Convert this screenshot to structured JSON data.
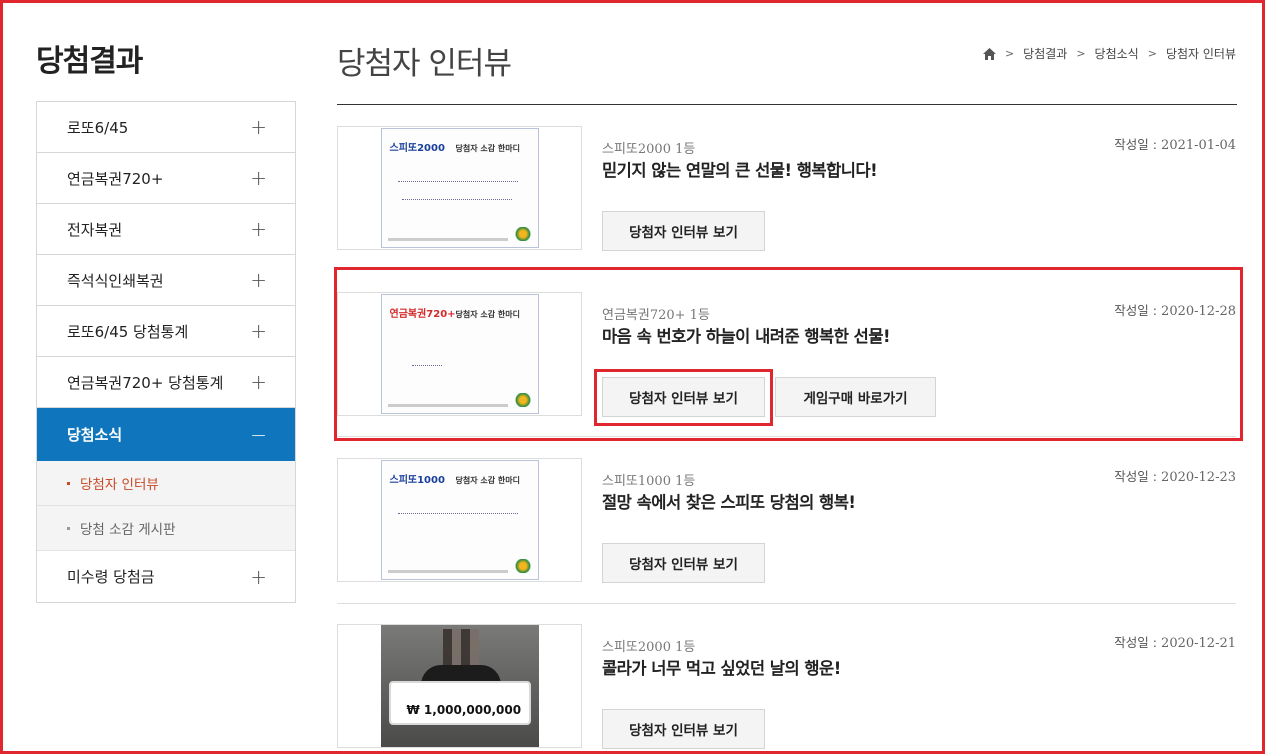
{
  "sidebar": {
    "title": "당첨결과",
    "items": [
      {
        "label": "로또6/45",
        "toggle": "+"
      },
      {
        "label": "연금복권720+",
        "toggle": "+"
      },
      {
        "label": "전자복권",
        "toggle": "+"
      },
      {
        "label": "즉석식인쇄복권",
        "toggle": "+"
      },
      {
        "label": "로또6/45 당첨통계",
        "toggle": "+"
      },
      {
        "label": "연금복권720+ 당첨통계",
        "toggle": "+"
      },
      {
        "label": "당첨소식",
        "toggle": "−"
      },
      {
        "label": "미수령 당첨금",
        "toggle": "+"
      }
    ],
    "subitems": [
      {
        "label": "당첨자 인터뷰"
      },
      {
        "label": "당첨 소감 게시판"
      }
    ]
  },
  "header": {
    "title": "당첨자 인터뷰",
    "breadcrumb": [
      "당첨결과",
      "당첨소식",
      "당첨자 인터뷰"
    ],
    "home_icon": "home-icon"
  },
  "interviews": [
    {
      "category": "스피또2000 1등",
      "title": "믿기지 않는 연말의 큰 선물! 행복합니다!",
      "date_label": "작성일 :",
      "date": "2021-01-04",
      "view_button": "당첨자 인터뷰 보기",
      "card_brand": "스피또2000",
      "card_title": "당첨자 소감 한마디"
    },
    {
      "category": "연금복권720+ 1등",
      "title": "마음 속 번호가 하늘이 내려준 행복한 선물!",
      "date_label": "작성일 :",
      "date": "2020-12-28",
      "view_button": "당첨자 인터뷰 보기",
      "game_button": "게임구매 바로가기",
      "card_brand": "연금복권720+",
      "card_title": "당첨자 소감 한마디"
    },
    {
      "category": "스피또1000 1등",
      "title": "절망 속에서 찾은 스피또 당첨의 행복!",
      "date_label": "작성일 :",
      "date": "2020-12-23",
      "view_button": "당첨자 인터뷰 보기",
      "card_brand": "스피또1000",
      "card_title": "당첨자 소감 한마디"
    },
    {
      "category": "스피또2000 1등",
      "title": "콜라가 너무 먹고 싶었던 날의 행운!",
      "date_label": "작성일 :",
      "date": "2020-12-21",
      "view_button": "당첨자 인터뷰 보기",
      "photo_amount": "₩ 1,000,000,000"
    }
  ],
  "colors": {
    "accent": "#0f76bd",
    "highlight": "#e0262e",
    "active_sub": "#c94b2a"
  }
}
